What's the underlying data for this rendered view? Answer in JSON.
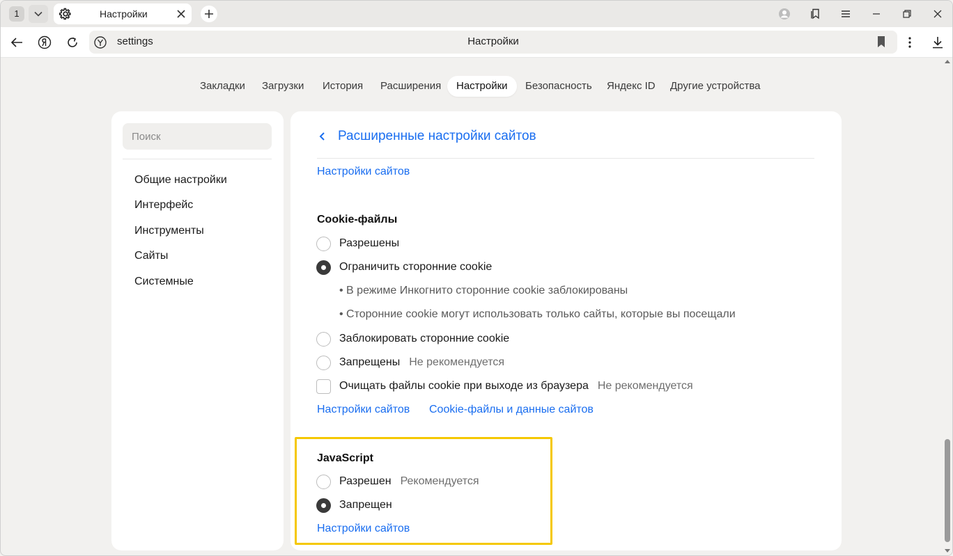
{
  "tabstrip": {
    "tab_count": "1",
    "active_tab_title": "Настройки"
  },
  "toolbar": {
    "url": "settings",
    "page_title": "Настройки"
  },
  "topnav": {
    "items": [
      {
        "label": "Закладки"
      },
      {
        "label": "Загрузки"
      },
      {
        "label": "История"
      },
      {
        "label": "Расширения"
      },
      {
        "label": "Настройки",
        "active": true
      },
      {
        "label": "Безопасность"
      },
      {
        "label": "Яндекс ID"
      },
      {
        "label": "Другие устройства"
      }
    ]
  },
  "sidebar": {
    "search_placeholder": "Поиск",
    "items": [
      {
        "label": "Общие настройки"
      },
      {
        "label": "Интерфейс"
      },
      {
        "label": "Инструменты"
      },
      {
        "label": "Сайты"
      },
      {
        "label": "Системные"
      }
    ]
  },
  "panel": {
    "title": "Расширенные настройки сайтов",
    "top_link": "Настройки сайтов",
    "cookies": {
      "heading": "Cookie-файлы",
      "options": [
        {
          "label": "Разрешены",
          "checked": false
        },
        {
          "label": "Ограничить сторонние cookie",
          "checked": true
        },
        {
          "label": "Заблокировать сторонние cookie",
          "checked": false
        },
        {
          "label": "Запрещены",
          "note": "Не рекомендуется",
          "checked": false
        }
      ],
      "bullets": [
        "• В режиме Инкогнито сторонние cookie заблокированы",
        "• Сторонние cookie могут использовать только сайты, которые вы посещали"
      ],
      "clear_on_exit": {
        "label": "Очищать файлы cookie при выходе из браузера",
        "note": "Не рекомендуется",
        "checked": false
      },
      "links": [
        "Настройки сайтов",
        "Cookie-файлы и данные сайтов"
      ]
    },
    "javascript": {
      "heading": "JavaScript",
      "options": [
        {
          "label": "Разрешен",
          "note": "Рекомендуется",
          "checked": false
        },
        {
          "label": "Запрещен",
          "checked": true
        }
      ],
      "link": "Настройки сайтов"
    }
  },
  "colors": {
    "accent_link": "#1a6ef0",
    "highlight_frame": "#f5c800"
  }
}
